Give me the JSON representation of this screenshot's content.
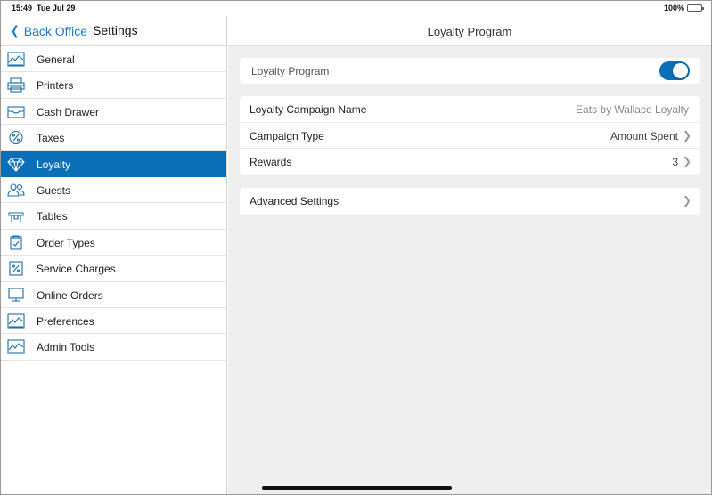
{
  "status": {
    "time": "15:49",
    "date": "Tue Jul 29",
    "battery": "100%"
  },
  "sidebar": {
    "back_label": "Back Office",
    "title": "Settings",
    "items": [
      {
        "label": "General",
        "icon": "chart-icon"
      },
      {
        "label": "Printers",
        "icon": "printer-icon"
      },
      {
        "label": "Cash Drawer",
        "icon": "cash-drawer-icon"
      },
      {
        "label": "Taxes",
        "icon": "percent-badge-icon"
      },
      {
        "label": "Loyalty",
        "icon": "diamond-icon",
        "active": true
      },
      {
        "label": "Guests",
        "icon": "guests-icon"
      },
      {
        "label": "Tables",
        "icon": "table-icon"
      },
      {
        "label": "Order Types",
        "icon": "clipboard-icon"
      },
      {
        "label": "Service Charges",
        "icon": "percent-doc-icon"
      },
      {
        "label": "Online Orders",
        "icon": "monitor-icon"
      },
      {
        "label": "Preferences",
        "icon": "chart-icon"
      },
      {
        "label": "Admin Tools",
        "icon": "chart-icon"
      }
    ]
  },
  "main": {
    "title": "Loyalty Program",
    "toggle": {
      "label": "Loyalty Program",
      "on": true
    },
    "rows": [
      {
        "label": "Loyalty Campaign Name",
        "value": "Eats by Wallace Loyalty"
      },
      {
        "label": "Campaign Type",
        "value": "Amount Spent"
      },
      {
        "label": "Rewards",
        "value": "3"
      }
    ],
    "advanced_label": "Advanced Settings"
  },
  "colors": {
    "accent": "#0a6fb6",
    "link": "#1a78c6",
    "background": "#efefef"
  }
}
